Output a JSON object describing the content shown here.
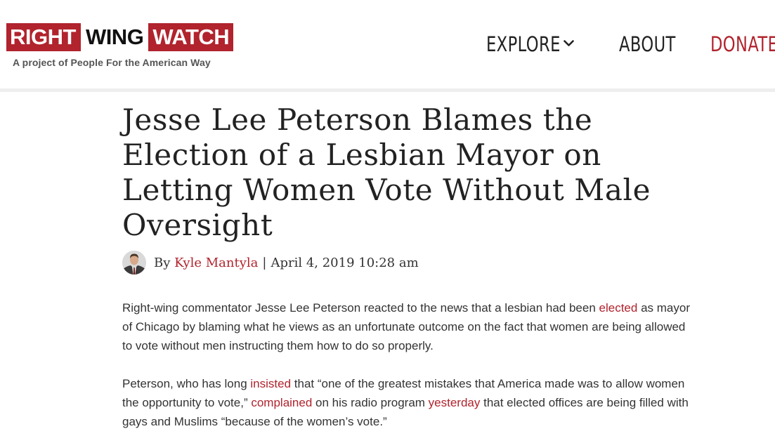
{
  "header": {
    "logo": {
      "word1": "RIGHT",
      "word2": "WING",
      "word3": "WATCH",
      "tagline": "A project of People For the American Way"
    },
    "nav": {
      "explore": "EXPLORE",
      "about": "ABOUT",
      "donate": "DONATE"
    }
  },
  "article": {
    "title": "Jesse Lee Peterson Blames the Election of a Lesbian Mayor on Letting Women Vote Without Male Oversight",
    "byline": {
      "by": "By",
      "author": "Kyle Mantyla",
      "separator": "|",
      "date": "April 4, 2019 10:28 am"
    },
    "paragraphs": [
      {
        "t1": "Right-wing commentator Jesse Lee Peterson reacted to the news that a lesbian had been ",
        "link1": "elected",
        "t2": " as mayor of Chicago by blaming what he views as an unfortunate outcome  on the fact that women are being allowed to vote without men instructing them how to do so properly."
      },
      {
        "t1": "Peterson, who has long ",
        "link1": "insisted",
        "t2": " that “one of the greatest mistakes that America made was to allow women the opportunity to vote,” ",
        "link2": "complained",
        "t3": " on his radio program ",
        "link3": "yesterday",
        "t4": " that elected offices are being filled with gays and Muslims “because of the women’s vote.”"
      }
    ]
  },
  "colors": {
    "brand_red": "#b1232d",
    "text": "#333333",
    "title": "#222222"
  },
  "icons": {
    "nav_dropdown": "chevron-down-icon",
    "author_avatar": "author-avatar"
  }
}
